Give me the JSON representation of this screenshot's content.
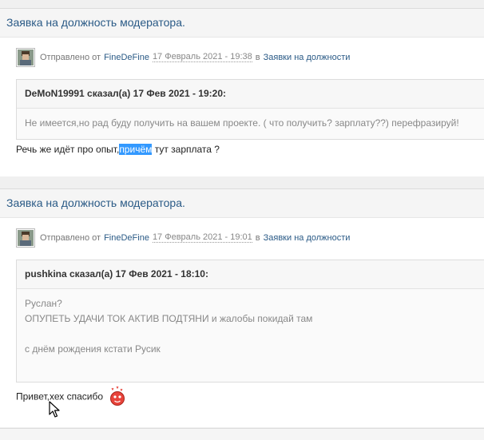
{
  "posts": [
    {
      "title": "Заявка на должность модератора.",
      "sent_label": "Отправлено от",
      "author": "FineDeFine",
      "date": "17 Февраль 2021 - 19:38",
      "in_label": "в",
      "forum": "Заявки на должности",
      "quote_header": "DeMoN19991 сказал(а) 17 Фев 2021 - 19:20:",
      "quote_lines": [
        "Не имеется,но рад буду получить на вашем проекте. ( что получить? зарплату??) перефразируй!"
      ],
      "reply_before": "Речь же идёт про опыт,",
      "reply_highlight": "причём",
      "reply_after": " тут зарплата ?"
    },
    {
      "title": "Заявка на должность модератора.",
      "sent_label": "Отправлено от",
      "author": "FineDeFine",
      "date": "17 Февраль 2021 - 19:01",
      "in_label": "в",
      "forum": "Заявки на должности",
      "quote_header": "pushkina сказал(а) 17 Фев 2021 - 18:10:",
      "quote_lines": [
        "Руслан?",
        "ОПУПЕТЬ УДАЧИ ТОК АКТИВ ПОДТЯНИ и жалобы покидай там",
        "",
        "с днём рождения кстати Русик"
      ],
      "reply_text": "Привет,хех спасибо",
      "reply_icon": "blushing-smiley-icon"
    }
  ],
  "icons": {
    "avatar": "user-avatar-icon",
    "cursor": "mouse-cursor-icon"
  },
  "colors": {
    "link": "#2a5a86",
    "highlight": "#3399ff",
    "smiley": "#e8433a"
  }
}
